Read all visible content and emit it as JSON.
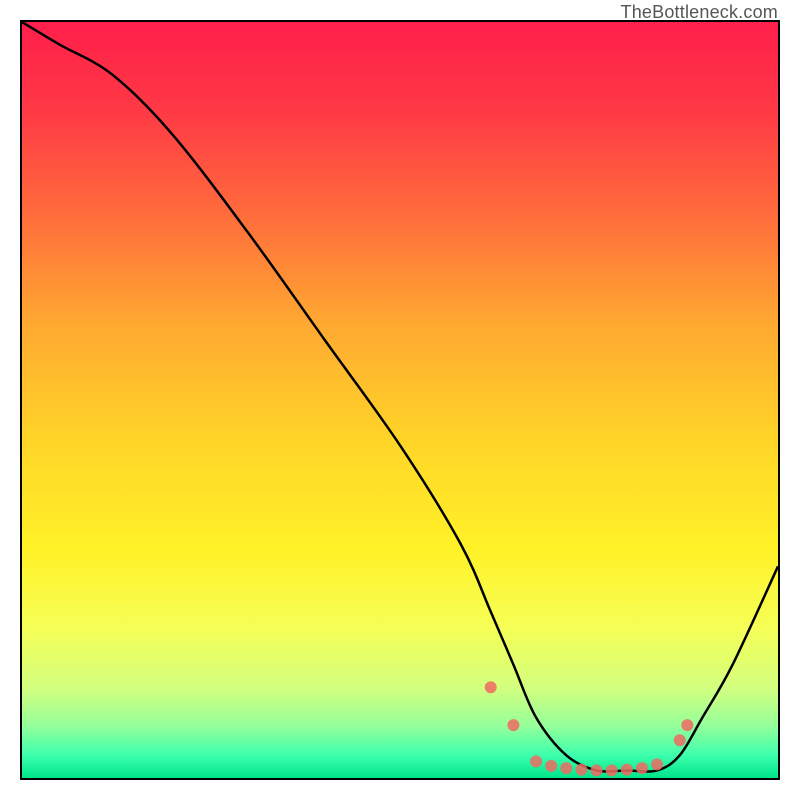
{
  "watermark": "TheBottleneck.com",
  "chart_data": {
    "type": "line",
    "title": "",
    "xlabel": "",
    "ylabel": "",
    "xlim": [
      0,
      100
    ],
    "ylim": [
      0,
      100
    ],
    "background_gradient_stops": [
      {
        "offset": 0.0,
        "color": "#ff1f4b"
      },
      {
        "offset": 0.12,
        "color": "#ff3a45"
      },
      {
        "offset": 0.25,
        "color": "#ff6a3c"
      },
      {
        "offset": 0.4,
        "color": "#ffa931"
      },
      {
        "offset": 0.55,
        "color": "#ffd428"
      },
      {
        "offset": 0.7,
        "color": "#fff228"
      },
      {
        "offset": 0.8,
        "color": "#f6ff56"
      },
      {
        "offset": 0.88,
        "color": "#d3ff7e"
      },
      {
        "offset": 0.93,
        "color": "#97ff9a"
      },
      {
        "offset": 0.97,
        "color": "#3dffad"
      },
      {
        "offset": 1.0,
        "color": "#00e58a"
      }
    ],
    "series": [
      {
        "name": "bottleneck-curve",
        "x": [
          0,
          5,
          12,
          20,
          30,
          40,
          50,
          58,
          62,
          65,
          68,
          72,
          76,
          80,
          84,
          87,
          90,
          94,
          100
        ],
        "y": [
          100,
          97,
          93,
          85,
          72,
          58,
          44,
          31,
          22,
          15,
          8,
          3,
          1,
          1,
          1,
          3,
          8,
          15,
          28
        ]
      }
    ],
    "markers": {
      "name": "highlight-dots",
      "color": "#f06a63",
      "radius": 6,
      "points": [
        {
          "x": 62,
          "y": 12
        },
        {
          "x": 65,
          "y": 7
        },
        {
          "x": 68,
          "y": 2.2
        },
        {
          "x": 70,
          "y": 1.6
        },
        {
          "x": 72,
          "y": 1.3
        },
        {
          "x": 74,
          "y": 1.1
        },
        {
          "x": 76,
          "y": 1.0
        },
        {
          "x": 78,
          "y": 1.0
        },
        {
          "x": 80,
          "y": 1.1
        },
        {
          "x": 82,
          "y": 1.3
        },
        {
          "x": 84,
          "y": 1.8
        },
        {
          "x": 87,
          "y": 5
        },
        {
          "x": 88,
          "y": 7
        }
      ]
    }
  }
}
